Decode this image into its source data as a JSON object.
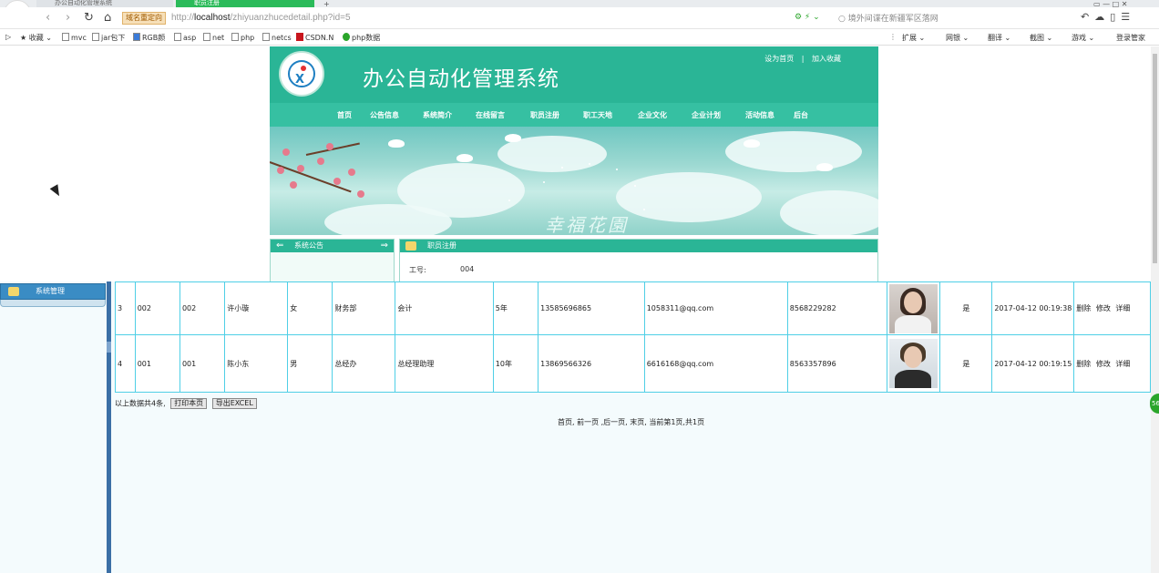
{
  "browser": {
    "logo_letter": "e",
    "tabs": [
      {
        "label": "办公自动化管理系统"
      },
      {
        "label": "职员注册"
      }
    ],
    "new_tab": "+",
    "window_controls": "▭  —  □  ✕",
    "redirect_label": "域名重定向",
    "url_prefix": "http://",
    "url_host": "localhost",
    "url_path": "/zhiyuanzhucedetail.php?id=5",
    "search_text": "境外间谍在新疆军区落网",
    "nav": {
      "back": "‹",
      "forward": "›",
      "reload": "↻",
      "home": "⌂"
    },
    "bookmarks": [
      {
        "label": "收藏"
      },
      {
        "label": "mvc"
      },
      {
        "label": "jar包下"
      },
      {
        "label": "RGB颜"
      },
      {
        "label": "asp"
      },
      {
        "label": "net"
      },
      {
        "label": "php"
      },
      {
        "label": "netcs"
      },
      {
        "label": "CSDN.N"
      },
      {
        "label": "php数据"
      }
    ],
    "right_bookmarks": [
      {
        "label": "扩展"
      },
      {
        "label": "网银"
      },
      {
        "label": "翻译"
      },
      {
        "label": "截图"
      },
      {
        "label": "游戏"
      },
      {
        "label": "登录管家"
      }
    ]
  },
  "site": {
    "title": "办公自动化管理系统",
    "top_links": [
      "设为首页",
      "加入收藏"
    ],
    "top_sep": "|",
    "menu": [
      "首页",
      "公告信息",
      "系统简介",
      "在线留言",
      "职员注册",
      "职工天地",
      "企业文化",
      "企业计划",
      "活动信息",
      "后台"
    ],
    "banner_text": "幸福花園",
    "notice_title": "系统公告",
    "register_title": "职员注册",
    "register_field_label": "工号:",
    "register_field_value": "004"
  },
  "admin": {
    "left_tab": "系统管理",
    "rows": [
      {
        "idx": "3",
        "id": "002",
        "code": "002",
        "name": "许小璇",
        "gender": "女",
        "dept": "财务部",
        "position": "会计",
        "years": "5年",
        "phone": "13585696865",
        "email": "1058311@qq.com",
        "tel": "8568229282",
        "approved": "是",
        "time": "2017-04-12 00:19:38",
        "ops": [
          "删除",
          "修改",
          "详细"
        ]
      },
      {
        "idx": "4",
        "id": "001",
        "code": "001",
        "name": "陈小东",
        "gender": "男",
        "dept": "总经办",
        "position": "总经理助理",
        "years": "10年",
        "phone": "13869566326",
        "email": "6616168@qq.com",
        "tel": "8563357896",
        "approved": "是",
        "time": "2017-04-12 00:19:15",
        "ops": [
          "删除",
          "修改",
          "详细"
        ]
      }
    ],
    "summary": "以上数据共4条,",
    "print_button": "打印本页",
    "excel_button": "导出EXCEL",
    "pager": "首页, 前一页 ,后一页, 末页, 当前第1页,共1页"
  },
  "float_badge": "56"
}
